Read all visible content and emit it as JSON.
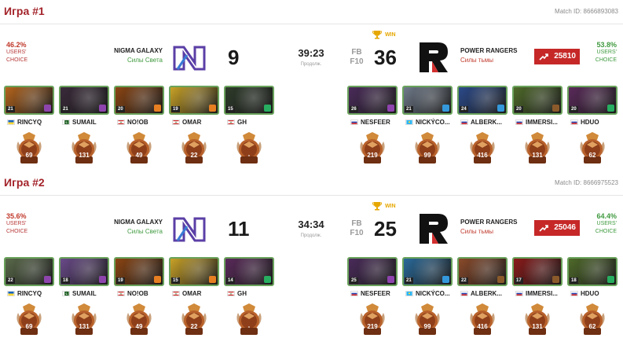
{
  "games": [
    {
      "title": "Игра #1",
      "match_id": "Match ID: 8666893083",
      "team1": {
        "name": "NIGMA GALAXY",
        "side": "Силы Света",
        "score": "9",
        "users_choice": {
          "pct": "46.2%",
          "label1": "USERS'",
          "label2": "CHOICE"
        },
        "players": [
          {
            "name": "RINCYQ",
            "flag": "UA",
            "level": "21",
            "rank": "69",
            "hero_color": "#b5651d",
            "item_color": "#8e44ad"
          },
          {
            "name": "SUMAIL",
            "flag": "PK",
            "level": "21",
            "rank": "131",
            "hero_color": "#3a2a3a",
            "item_color": "#8e44ad"
          },
          {
            "name": "NO!OB",
            "flag": "LB",
            "level": "20",
            "rank": "49",
            "hero_color": "#8b4513",
            "item_color": "#e67e22"
          },
          {
            "name": "OMAR",
            "flag": "LB",
            "level": "19",
            "rank": "22",
            "hero_color": "#c9a227",
            "item_color": "#e67e22"
          },
          {
            "name": "GH",
            "flag": "LB",
            "level": "15",
            "rank": "-",
            "hero_color": "#2e3b2a",
            "item_color": "#27ae60"
          }
        ]
      },
      "duration": "39:23",
      "duration_label": "Продолж.",
      "fb": "FB",
      "f10": "F10",
      "win_label": "WIN",
      "team2": {
        "name": "POWER RANGERS",
        "side": "Силы тьмы",
        "score": "36",
        "rating": "25810",
        "users_choice": {
          "pct": "53.8%",
          "label1": "USERS'",
          "label2": "CHOICE"
        },
        "players": [
          {
            "name": "NESFEER",
            "flag": "RU",
            "level": "26",
            "rank": "219",
            "hero_color": "#4a2b5a",
            "item_color": "#8e44ad"
          },
          {
            "name": "NICKÝCO...",
            "flag": "KZ",
            "level": "21",
            "rank": "99",
            "hero_color": "#6f7a8a",
            "item_color": "#3498db"
          },
          {
            "name": "ALBERK...",
            "flag": "RU",
            "level": "24",
            "rank": "416",
            "hero_color": "#2b4a8a",
            "item_color": "#3498db"
          },
          {
            "name": "IMMERSI...",
            "flag": "RU",
            "level": "20",
            "rank": "131",
            "hero_color": "#4f6a2a",
            "item_color": "#8b5a2b"
          },
          {
            "name": "HDUO",
            "flag": "RU",
            "level": "20",
            "rank": "62",
            "hero_color": "#5a2a5a",
            "item_color": "#27ae60"
          }
        ]
      }
    },
    {
      "title": "Игра #2",
      "match_id": "Match ID: 8666975523",
      "team1": {
        "name": "NIGMA GALAXY",
        "side": "Силы Света",
        "score": "11",
        "users_choice": {
          "pct": "35.6%",
          "label1": "USERS'",
          "label2": "CHOICE"
        },
        "players": [
          {
            "name": "RINCYQ",
            "flag": "UA",
            "level": "22",
            "rank": "69",
            "hero_color": "#5a6a4a",
            "item_color": "#8e44ad"
          },
          {
            "name": "SUMAIL",
            "flag": "PK",
            "level": "18",
            "rank": "131",
            "hero_color": "#6a4a8a",
            "item_color": "#8e44ad"
          },
          {
            "name": "NO!OB",
            "flag": "LB",
            "level": "19",
            "rank": "49",
            "hero_color": "#8b4513",
            "item_color": "#e67e22"
          },
          {
            "name": "OMAR",
            "flag": "LB",
            "level": "15",
            "rank": "22",
            "hero_color": "#c9a227",
            "item_color": "#e67e22"
          },
          {
            "name": "GH",
            "flag": "LB",
            "level": "14",
            "rank": "-",
            "hero_color": "#5a2a5a",
            "item_color": "#27ae60"
          }
        ]
      },
      "duration": "34:34",
      "duration_label": "Продолж.",
      "fb": "FB",
      "f10": "F10",
      "win_label": "WIN",
      "team2": {
        "name": "POWER RANGERS",
        "side": "Силы тьмы",
        "score": "25",
        "rating": "25046",
        "users_choice": {
          "pct": "64.4%",
          "label1": "USERS'",
          "label2": "CHOICE"
        },
        "players": [
          {
            "name": "NESFEER",
            "flag": "RU",
            "level": "25",
            "rank": "219",
            "hero_color": "#4a2b5a",
            "item_color": "#8e44ad"
          },
          {
            "name": "NICKÝCO...",
            "flag": "KZ",
            "level": "21",
            "rank": "99",
            "hero_color": "#2a6a9a",
            "item_color": "#3498db"
          },
          {
            "name": "ALBERK...",
            "flag": "RU",
            "level": "22",
            "rank": "416",
            "hero_color": "#8a4a2a",
            "item_color": "#8b5a2b"
          },
          {
            "name": "IMMERSI...",
            "flag": "RU",
            "level": "17",
            "rank": "131",
            "hero_color": "#8a1a1a",
            "item_color": "#8b5a2b"
          },
          {
            "name": "HDUO",
            "flag": "RU",
            "level": "18",
            "rank": "62",
            "hero_color": "#4f6a2a",
            "item_color": "#27ae60"
          }
        ]
      }
    }
  ],
  "colors": {
    "accent": "#a3242b",
    "win_green": "#6aa35c",
    "rating_red": "#c62828",
    "win_gold": "#e6a700",
    "nigma_purple": "#5b3fa6"
  }
}
